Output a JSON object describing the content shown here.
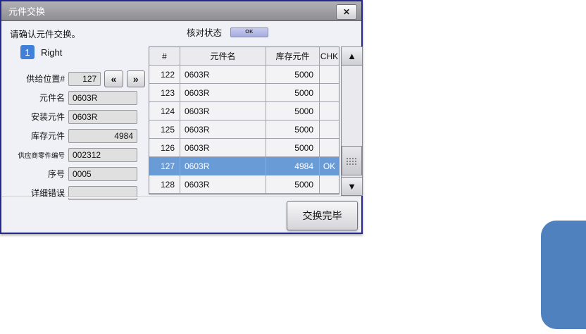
{
  "dialog": {
    "title": "元件交换",
    "close_label": "✕",
    "instruction": "请确认元件交换。",
    "check_status": {
      "label": "核对状态",
      "value": "OK"
    },
    "head": {
      "index": "1",
      "side": "Right"
    },
    "nav": {
      "prev": "«",
      "next": "»"
    },
    "fields": [
      {
        "label": "供给位置#",
        "value": "127"
      },
      {
        "label": "元件名",
        "value": "0603R"
      },
      {
        "label": "安装元件",
        "value": "0603R"
      },
      {
        "label": "库存元件",
        "value": "4984"
      },
      {
        "label": "供应商零件编号",
        "value": "002312"
      },
      {
        "label": "序号",
        "value": "0005"
      },
      {
        "label": "详细错误",
        "value": ""
      }
    ],
    "table": {
      "columns": [
        "#",
        "元件名",
        "库存元件",
        "CHK"
      ],
      "rows": [
        {
          "num": "122",
          "name": "0603R",
          "stock": "5000",
          "chk": ""
        },
        {
          "num": "123",
          "name": "0603R",
          "stock": "5000",
          "chk": ""
        },
        {
          "num": "124",
          "name": "0603R",
          "stock": "5000",
          "chk": ""
        },
        {
          "num": "125",
          "name": "0603R",
          "stock": "5000",
          "chk": ""
        },
        {
          "num": "126",
          "name": "0603R",
          "stock": "5000",
          "chk": ""
        },
        {
          "num": "127",
          "name": "0603R",
          "stock": "4984",
          "chk": "OK"
        },
        {
          "num": "128",
          "name": "0603R",
          "stock": "5000",
          "chk": ""
        }
      ],
      "scrollbar": {
        "up": "▲",
        "down": "▼"
      }
    },
    "done_button": "交换完毕"
  },
  "colors": {
    "dialog_border": "#26268f",
    "titlebar_gray": "#9b9b9f",
    "selected_row_blue": "#699bd7",
    "index_badge_blue": "#3f80d8",
    "status_badge_lavender": "#b0b5e2",
    "corner_shape_blue": "#4e81bd"
  }
}
